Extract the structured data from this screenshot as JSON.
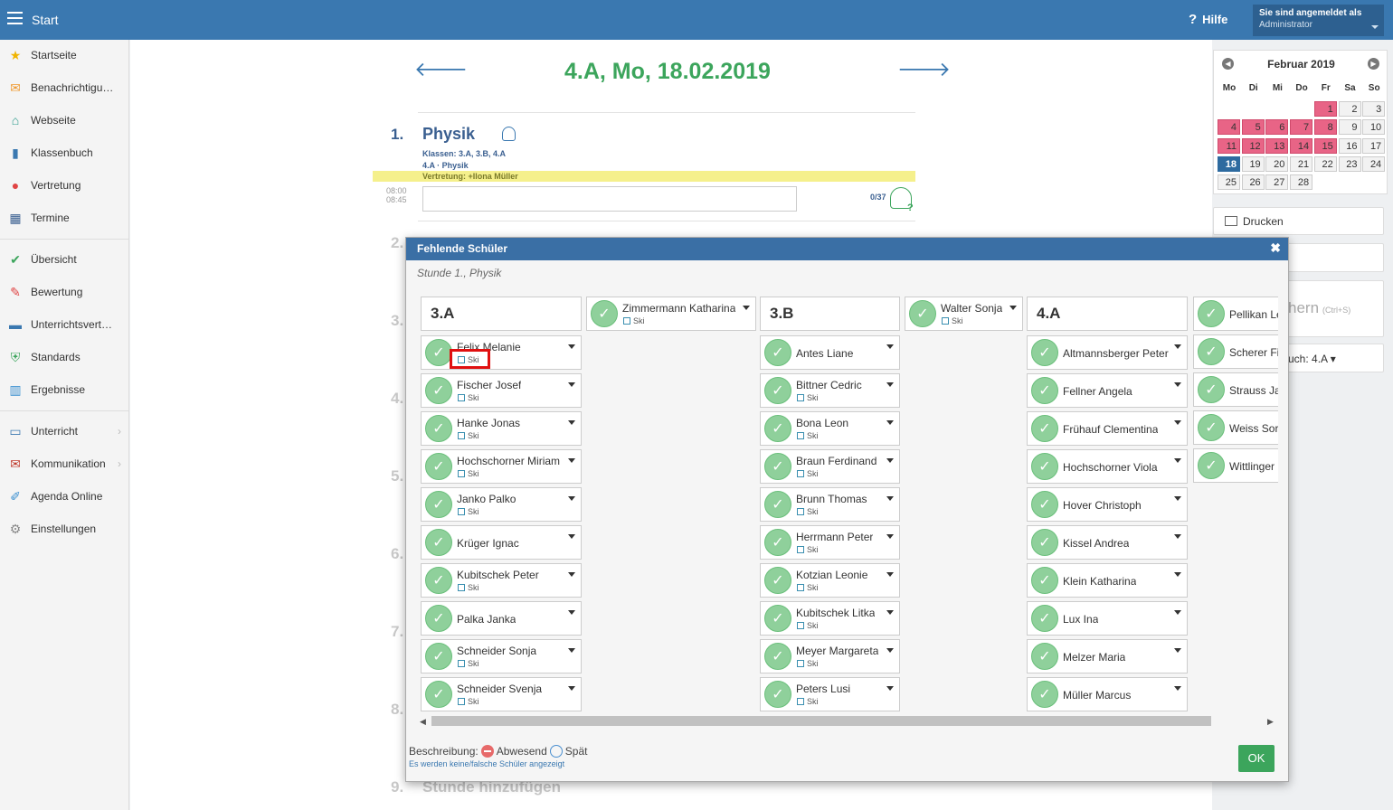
{
  "topbar": {
    "title": "Start",
    "help": "Hilfe",
    "help_icon": "?",
    "user_line1": "Sie sind angemeldet als",
    "user_line2": "Administrator"
  },
  "sidebar": {
    "items": [
      {
        "label": "Startseite",
        "icon": "star-icon",
        "glyph": "★",
        "color": "#f0b400"
      },
      {
        "label": "Benachrichtigu…",
        "icon": "envelope-icon",
        "glyph": "✉",
        "color": "#f09a30"
      },
      {
        "label": "Webseite",
        "icon": "home-icon",
        "glyph": "⌂",
        "color": "#2a9a8a"
      },
      {
        "label": "Klassenbuch",
        "icon": "book-icon",
        "glyph": "▮",
        "color": "#3a78b0"
      },
      {
        "label": "Vertretung",
        "icon": "person-icon",
        "glyph": "●",
        "color": "#e04444"
      },
      {
        "label": "Termine",
        "icon": "calendar-icon",
        "glyph": "▦",
        "color": "#3a5f90"
      },
      {
        "label": "Übersicht",
        "icon": "check-circle-icon",
        "glyph": "✔",
        "color": "#3ca55c"
      },
      {
        "label": "Bewertung",
        "icon": "rating-icon",
        "glyph": "✎",
        "color": "#e04444"
      },
      {
        "label": "Unterrichtsvert…",
        "icon": "briefcase-icon",
        "glyph": "▬",
        "color": "#3a78b0"
      },
      {
        "label": "Standards",
        "icon": "shield-icon",
        "glyph": "⛨",
        "color": "#3ca55c"
      },
      {
        "label": "Ergebnisse",
        "icon": "bar-chart-icon",
        "glyph": "▥",
        "color": "#3a8fd0"
      },
      {
        "label": "Unterricht",
        "icon": "chalkboard-icon",
        "glyph": "▭",
        "color": "#3a78b0",
        "arrow": "›"
      },
      {
        "label": "Kommunikation",
        "icon": "chat-icon",
        "glyph": "✉",
        "color": "#c0392b",
        "arrow": "›"
      },
      {
        "label": "Agenda Online",
        "icon": "pen-icon",
        "glyph": "✐",
        "color": "#3a8fd0"
      },
      {
        "label": "Einstellungen",
        "icon": "gear-icon",
        "glyph": "⚙",
        "color": "#888"
      }
    ]
  },
  "main": {
    "date_header": "4.A, Mo, 18.02.2019",
    "prev": "🡐",
    "next": "🡒",
    "lesson1": {
      "num": "1.",
      "subject": "Physik",
      "classes": "Klassen:  3.A, 3.B, 4.A",
      "class_subject": "4.A · Physik",
      "substitution": "Vertretung:   +Ilona Müller",
      "time_from": "08:00",
      "time_to": "08:45",
      "count": "0/37"
    },
    "lesson_numbers": [
      "2.",
      "3.",
      "4.",
      "5.",
      "6.",
      "7.",
      "8.",
      "9."
    ],
    "add_lesson": "Stunde hinzufügen"
  },
  "calendar": {
    "title": "Februar 2019",
    "prev": "◀",
    "next": "▶",
    "weekdays": [
      "Mo",
      "Di",
      "Mi",
      "Do",
      "Fr",
      "Sa",
      "So"
    ],
    "days": [
      {
        "d": "1",
        "hol": true
      },
      {
        "d": "2"
      },
      {
        "d": "3"
      },
      {
        "d": "4",
        "hol": true
      },
      {
        "d": "5",
        "hol": true
      },
      {
        "d": "6",
        "hol": true
      },
      {
        "d": "7",
        "hol": true
      },
      {
        "d": "8",
        "hol": true
      },
      {
        "d": "9"
      },
      {
        "d": "10"
      },
      {
        "d": "11",
        "hol": true
      },
      {
        "d": "12",
        "hol": true
      },
      {
        "d": "13",
        "hol": true
      },
      {
        "d": "14",
        "hol": true
      },
      {
        "d": "15",
        "hol": true
      },
      {
        "d": "16"
      },
      {
        "d": "17"
      },
      {
        "d": "18",
        "today": true
      },
      {
        "d": "19"
      },
      {
        "d": "20"
      },
      {
        "d": "21"
      },
      {
        "d": "22"
      },
      {
        "d": "23"
      },
      {
        "d": "24"
      },
      {
        "d": "25"
      },
      {
        "d": "26"
      },
      {
        "d": "27"
      },
      {
        "d": "28"
      }
    ]
  },
  "right": {
    "print": "Drucken",
    "partial_text": "hern",
    "partial_shortcut": "(Ctrl+S)",
    "partial_class": "uch: 4.A ▾"
  },
  "modal": {
    "title": "Fehlende Schüler",
    "close": "✖",
    "subtitle": "Stunde 1., Physik",
    "ok_glyph": "✓",
    "columns": [
      {
        "class": "3.A",
        "students": [
          {
            "name": "Felix Melanie",
            "tag": "Ski"
          },
          {
            "name": "Fischer Josef",
            "tag": "Ski"
          },
          {
            "name": "Hanke Jonas",
            "tag": "Ski"
          },
          {
            "name": "Hochschorner Miriam",
            "tag": "Ski"
          },
          {
            "name": "Janko Palko",
            "tag": "Ski"
          },
          {
            "name": "Krüger Ignac"
          },
          {
            "name": "Kubitschek Peter",
            "tag": "Ski"
          },
          {
            "name": "Palka Janka"
          },
          {
            "name": "Schneider Sonja",
            "tag": "Ski"
          },
          {
            "name": "Schneider Svenja",
            "tag": "Ski"
          }
        ],
        "extra": {
          "name": "Zimmermann Katharina",
          "tag": "Ski"
        }
      },
      {
        "class": "3.B",
        "students": [
          {
            "name": "Antes Liane"
          },
          {
            "name": "Bittner Cedric",
            "tag": "Ski"
          },
          {
            "name": "Bona Leon",
            "tag": "Ski"
          },
          {
            "name": "Braun Ferdinand",
            "tag": "Ski"
          },
          {
            "name": "Brunn Thomas",
            "tag": "Ski"
          },
          {
            "name": "Herrmann Peter",
            "tag": "Ski"
          },
          {
            "name": "Kotzian Leonie",
            "tag": "Ski"
          },
          {
            "name": "Kubitschek Litka",
            "tag": "Ski"
          },
          {
            "name": "Meyer Margareta",
            "tag": "Ski"
          },
          {
            "name": "Peters Lusi",
            "tag": "Ski"
          }
        ],
        "extra": {
          "name": "Walter Sonja",
          "tag": "Ski"
        }
      },
      {
        "class": "4.A",
        "students": [
          {
            "name": "Altmannsberger Peter"
          },
          {
            "name": "Fellner Angela"
          },
          {
            "name": "Frühauf Clementina"
          },
          {
            "name": "Hochschorner Viola"
          },
          {
            "name": "Hover Christoph"
          },
          {
            "name": "Kissel Andrea"
          },
          {
            "name": "Klein Katharina"
          },
          {
            "name": "Lux Ina"
          },
          {
            "name": "Melzer Maria"
          },
          {
            "name": "Müller Marcus"
          }
        ],
        "extra_list": [
          {
            "name": "Pellikan Le"
          },
          {
            "name": "Scherer Fi"
          },
          {
            "name": "Strauss Ja"
          },
          {
            "name": "Weiss Sor"
          },
          {
            "name": "Wittlinger"
          }
        ]
      }
    ],
    "legend_label": "Beschreibung:",
    "legend_absent": "Abwesend",
    "legend_late": "Spät",
    "note": "Es werden keine/falsche Schüler angezeigt",
    "ok": "OK",
    "scroll_left": "◀",
    "scroll_right": "▶"
  }
}
